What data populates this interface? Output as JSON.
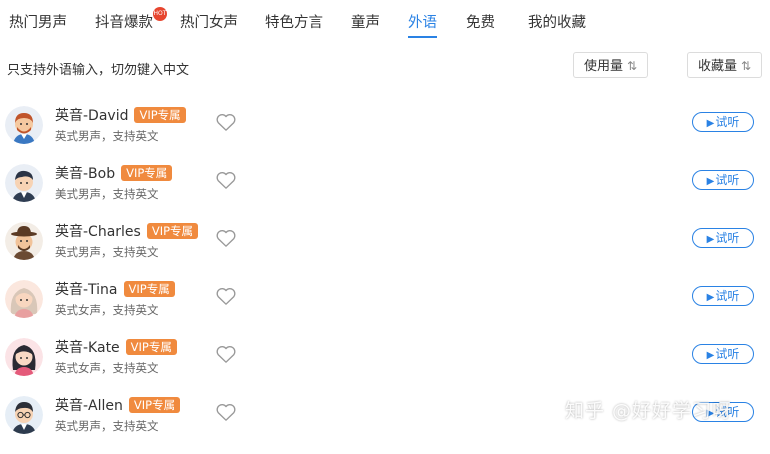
{
  "tabs": [
    {
      "label": "热门男声",
      "active": false
    },
    {
      "label": "抖音爆款",
      "active": false,
      "badge": "HOT"
    },
    {
      "label": "热门女声",
      "active": false
    },
    {
      "label": "特色方言",
      "active": false
    },
    {
      "label": "童声",
      "active": false
    },
    {
      "label": "外语",
      "active": true
    },
    {
      "label": "免费",
      "active": false
    },
    {
      "label": "我的收藏",
      "active": false
    }
  ],
  "hint": "只支持外语输入，切勿键入中文",
  "sort": {
    "usage_label": "使用量",
    "favorites_label": "收藏量",
    "icon": "sort-icon"
  },
  "voices": [
    {
      "name": "英音-David",
      "vip": "VIP专属",
      "desc": "英式男声，支持英文",
      "play": "试听"
    },
    {
      "name": "美音-Bob",
      "vip": "VIP专属",
      "desc": "美式男声，支持英文",
      "play": "试听"
    },
    {
      "name": "英音-Charles",
      "vip": "VIP专属",
      "desc": "英式男声，支持英文",
      "play": "试听"
    },
    {
      "name": "英音-Tina",
      "vip": "VIP专属",
      "desc": "英式女声，支持英文",
      "play": "试听"
    },
    {
      "name": "英音-Kate",
      "vip": "VIP专属",
      "desc": "英式女声，支持英文",
      "play": "试听"
    },
    {
      "name": "英音-Allen",
      "vip": "VIP专属",
      "desc": "英式男声，支持英文",
      "play": "试听"
    }
  ],
  "watermark": "知乎 @好好学习呀",
  "colors": {
    "accent": "#2a82e4",
    "vip": "#f08a3e",
    "hot": "#e7462f"
  }
}
